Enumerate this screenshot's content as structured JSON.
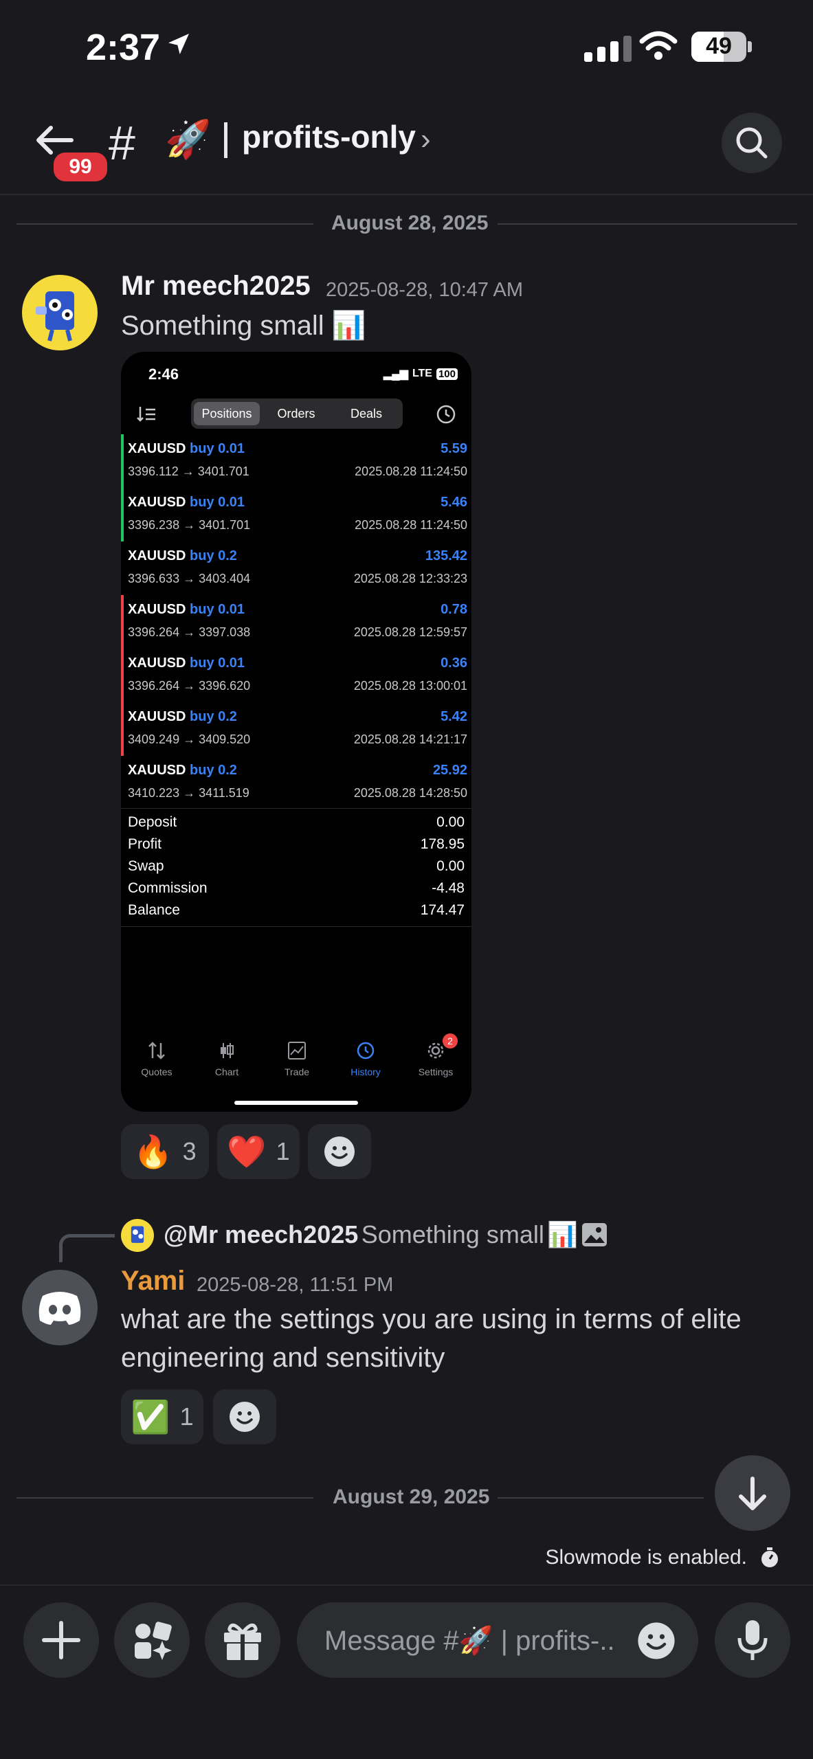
{
  "status_bar": {
    "time": "2:37",
    "battery": "49"
  },
  "header": {
    "unread_badge": "99",
    "channel_hash": "#",
    "channel_emoji": "🚀",
    "channel_name": "profits-only",
    "chevron": "›"
  },
  "dividers": [
    {
      "label": "August 28, 2025"
    },
    {
      "label": "August 29, 2025"
    }
  ],
  "message1": {
    "author": "Mr meech2025",
    "timestamp": "2025-08-28, 10:47 AM",
    "text": "Something small",
    "text_emoji": "📊",
    "reactions": [
      {
        "emoji": "🔥",
        "count": "3"
      },
      {
        "emoji": "❤️",
        "count": "1"
      }
    ]
  },
  "attachment": {
    "status_time": "2:46",
    "status_net": "LTE",
    "status_battery": "100",
    "tabs": [
      "Positions",
      "Orders",
      "Deals"
    ],
    "active_tab": "Positions",
    "trades": [
      {
        "symbol": "XAUUSD",
        "side": "buy 0.01",
        "pnl": "5.59",
        "prices": "3396.112 → 3401.701",
        "datetime": "2025.08.28 11:24:50",
        "bar": "#22c55e"
      },
      {
        "symbol": "XAUUSD",
        "side": "buy 0.01",
        "pnl": "5.46",
        "prices": "3396.238 → 3401.701",
        "datetime": "2025.08.28 11:24:50",
        "bar": "#22c55e"
      },
      {
        "symbol": "XAUUSD",
        "side": "buy 0.2",
        "pnl": "135.42",
        "prices": "3396.633 → 3403.404",
        "datetime": "2025.08.28 12:33:23",
        "bar": ""
      },
      {
        "symbol": "XAUUSD",
        "side": "buy 0.01",
        "pnl": "0.78",
        "prices": "3396.264 → 3397.038",
        "datetime": "2025.08.28 12:59:57",
        "bar": "#ef4444"
      },
      {
        "symbol": "XAUUSD",
        "side": "buy 0.01",
        "pnl": "0.36",
        "prices": "3396.264 → 3396.620",
        "datetime": "2025.08.28 13:00:01",
        "bar": "#ef4444"
      },
      {
        "symbol": "XAUUSD",
        "side": "buy 0.2",
        "pnl": "5.42",
        "prices": "3409.249 → 3409.520",
        "datetime": "2025.08.28 14:21:17",
        "bar": "#ef4444"
      },
      {
        "symbol": "XAUUSD",
        "side": "buy 0.2",
        "pnl": "25.92",
        "prices": "3410.223 → 3411.519",
        "datetime": "2025.08.28 14:28:50",
        "bar": ""
      }
    ],
    "summary": [
      {
        "label": "Deposit",
        "value": "0.00"
      },
      {
        "label": "Profit",
        "value": "178.95"
      },
      {
        "label": "Swap",
        "value": "0.00"
      },
      {
        "label": "Commission",
        "value": "-4.48"
      },
      {
        "label": "Balance",
        "value": "174.47"
      }
    ],
    "bottom_tabs": [
      "Quotes",
      "Chart",
      "Trade",
      "History",
      "Settings"
    ],
    "active_bottom_tab": "History",
    "settings_badge": "2"
  },
  "message2": {
    "reply_to_author": "@Mr meech2025",
    "reply_to_text": "Something small",
    "reply_emoji": "📊",
    "author": "Yami",
    "author_color": "#e89a3c",
    "timestamp": "2025-08-28, 11:51 PM",
    "text_line1": "what are the settings you are using in terms of elite",
    "text_line2": "engineering and sensitivity",
    "reactions": [
      {
        "emoji": "✅",
        "count": "1"
      }
    ]
  },
  "slowmode": {
    "text": "Slowmode is enabled."
  },
  "composer": {
    "placeholder": "Message #🚀 | profits-.."
  }
}
